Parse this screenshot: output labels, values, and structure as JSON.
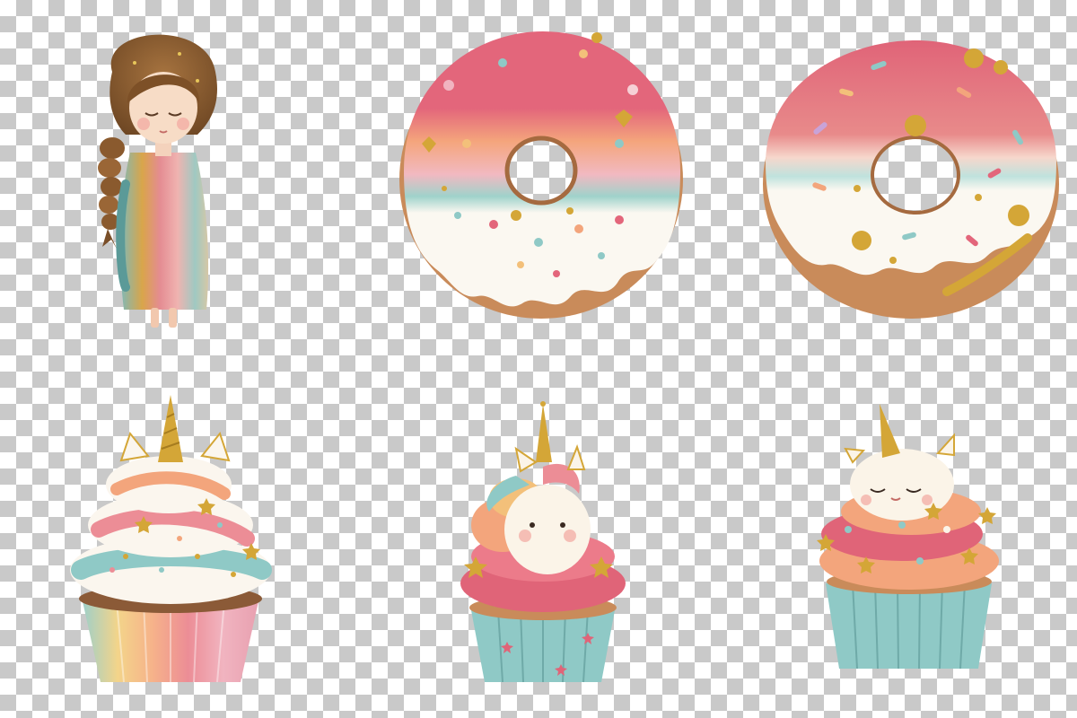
{
  "background": {
    "pattern": "transparency-checkerboard",
    "colors": [
      "#ffffff",
      "#c9c9c9"
    ]
  },
  "clipart": [
    {
      "id": "girl",
      "name": "watercolor-girl-rainbow-dress"
    },
    {
      "id": "donut1",
      "name": "rainbow-glazed-donut"
    },
    {
      "id": "donut2",
      "name": "pink-glazed-donut-gold-sprinkles"
    },
    {
      "id": "cup1",
      "name": "unicorn-rainbow-swirl-cupcake"
    },
    {
      "id": "cup2",
      "name": "unicorn-head-cupcake"
    },
    {
      "id": "cup3",
      "name": "sleeping-unicorn-cupcake"
    }
  ],
  "palette": {
    "pink": "#e06478",
    "peach": "#f2a37a",
    "teal": "#8fc9c6",
    "cream": "#fbf4e8",
    "gold": "#d4a637",
    "dough": "#c98b5a"
  }
}
